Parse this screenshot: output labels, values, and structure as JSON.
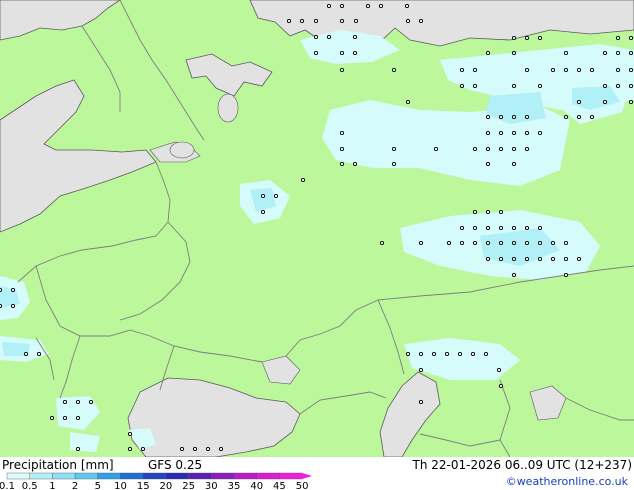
{
  "footer": {
    "title": "Precipitation [mm]",
    "model": "GFS 0.25",
    "datetime": "Th 22-01-2026 06..09 UTC (12+237)",
    "credit": "©weatheronline.co.uk"
  },
  "colorbar": {
    "labels": [
      "0.1",
      "0.5",
      "1",
      "2",
      "5",
      "10",
      "15",
      "20",
      "25",
      "30",
      "35",
      "40",
      "45",
      "50"
    ],
    "colors": [
      "#dcfbfb",
      "#b4f0f8",
      "#8ce0f5",
      "#5fc8f0",
      "#2f9fe6",
      "#1e6fd8",
      "#1f46c8",
      "#2b2ab4",
      "#5a1fb4",
      "#8c1ebe",
      "#b81ec8",
      "#dc1ed2",
      "#f01edc"
    ]
  },
  "map": {
    "colors": {
      "land": "#bcf79c",
      "sea": "#e2e2e2",
      "precip_light": "#d6fbfb",
      "precip_medium": "#b0f0f6",
      "border": "#7d7d7d",
      "coast": "#5a5a5a"
    }
  }
}
